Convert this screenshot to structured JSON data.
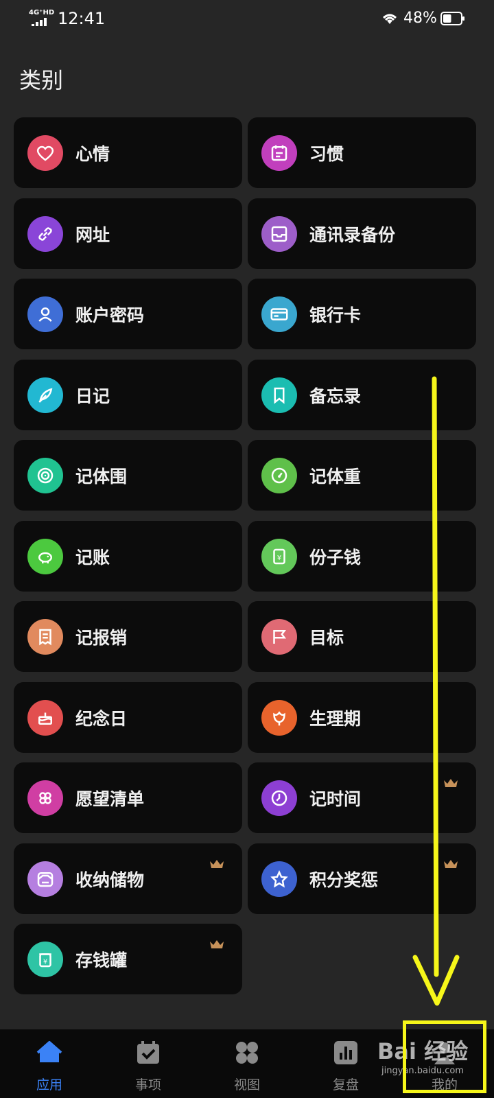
{
  "status_bar": {
    "network": "4G⁺HD",
    "time": "12:41",
    "battery_percent": "48%",
    "battery_level": 0.48
  },
  "header": {
    "title": "类别"
  },
  "categories": [
    {
      "label": "心情",
      "icon": "heart-icon",
      "color": "#e14a63",
      "crown": false
    },
    {
      "label": "习惯",
      "icon": "calendar-icon",
      "color": "#c13fbd",
      "crown": false
    },
    {
      "label": "网址",
      "icon": "link-icon",
      "color": "#8a45d8",
      "crown": false
    },
    {
      "label": "通讯录备份",
      "icon": "inbox-icon",
      "color": "#9d5ec9",
      "crown": false
    },
    {
      "label": "账户密码",
      "icon": "user-icon",
      "color": "#3f6ed6",
      "crown": false
    },
    {
      "label": "银行卡",
      "icon": "credit-card-icon",
      "color": "#3aa7cf",
      "crown": false
    },
    {
      "label": "日记",
      "icon": "feather-icon",
      "color": "#22b8d2",
      "crown": false
    },
    {
      "label": "备忘录",
      "icon": "bookmark-icon",
      "color": "#1bbdb1",
      "crown": false
    },
    {
      "label": "记体围",
      "icon": "target-icon",
      "color": "#20c391",
      "crown": false
    },
    {
      "label": "记体重",
      "icon": "gauge-icon",
      "color": "#5fc04a",
      "crown": false
    },
    {
      "label": "记账",
      "icon": "piggy-bank-icon",
      "color": "#4cc93f",
      "crown": false
    },
    {
      "label": "份子钱",
      "icon": "money-envelope-icon",
      "color": "#63c85a",
      "crown": false
    },
    {
      "label": "记报销",
      "icon": "receipt-icon",
      "color": "#e18a5e",
      "crown": false
    },
    {
      "label": "目标",
      "icon": "flag-icon",
      "color": "#e06a74",
      "crown": false
    },
    {
      "label": "纪念日",
      "icon": "cake-icon",
      "color": "#e24f4f",
      "crown": false
    },
    {
      "label": "生理期",
      "icon": "flower-icon",
      "color": "#e8632c",
      "crown": false
    },
    {
      "label": "愿望清单",
      "icon": "clover-icon",
      "color": "#d03ea3",
      "crown": false
    },
    {
      "label": "记时间",
      "icon": "clock-icon",
      "color": "#8d3fd3",
      "crown": true
    },
    {
      "label": "收纳储物",
      "icon": "storage-icon",
      "color": "#b57fe0",
      "crown": true
    },
    {
      "label": "积分奖惩",
      "icon": "star-icon",
      "color": "#3d62d0",
      "crown": true
    },
    {
      "label": "存钱罐",
      "icon": "money-jar-icon",
      "color": "#2ec4a5",
      "crown": true
    }
  ],
  "tab_bar": [
    {
      "label": "应用",
      "icon": "home-icon",
      "active": true
    },
    {
      "label": "事项",
      "icon": "calendar-check-icon",
      "active": false
    },
    {
      "label": "视图",
      "icon": "grid-icon",
      "active": false
    },
    {
      "label": "复盘",
      "icon": "bar-chart-icon",
      "active": false
    },
    {
      "label": "我的",
      "icon": "profile-icon",
      "active": false
    }
  ],
  "watermark": {
    "main": "Bai 经验",
    "url": "jingyan.baidu.com"
  },
  "colors": {
    "background": "#262626",
    "card": "#0c0c0c",
    "accent": "#3b82f6",
    "annotation": "#f6f61a",
    "crown": "#c7925a"
  }
}
